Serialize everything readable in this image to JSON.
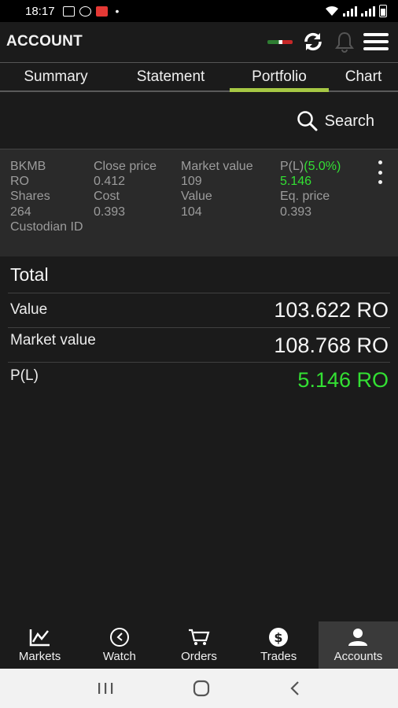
{
  "status_bar": {
    "time": "18:17",
    "dot": "•"
  },
  "header": {
    "title": "ACCOUNT"
  },
  "tabs": [
    {
      "label": "Summary"
    },
    {
      "label": "Statement"
    },
    {
      "label": "Portfolio",
      "active": true
    },
    {
      "label": "Chart"
    }
  ],
  "search": {
    "label": "Search"
  },
  "holding": {
    "symbol": "BKMB",
    "currency": "RO",
    "close_price_label": "Close price",
    "close_price": "0.412",
    "market_value_label": "Market value",
    "market_value": "109",
    "pl_label": "P(L)",
    "pl_percent": "(5.0%)",
    "pl_value": "5.146",
    "shares_label": "Shares",
    "shares": "264",
    "cost_label": "Cost",
    "cost": "0.393",
    "value_label": "Value",
    "value": "104",
    "eq_price_label": "Eq. price",
    "eq_price": "0.393",
    "custodian_label": "Custodian ID"
  },
  "total": {
    "title": "Total",
    "rows": [
      {
        "label": "Value",
        "value": "103.622 RO"
      },
      {
        "label": "Market value",
        "value": "108.768 RO"
      },
      {
        "label": "P(L)",
        "value": "5.146 RO"
      }
    ]
  },
  "bottom_nav": [
    {
      "label": "Markets",
      "icon": "chart-icon"
    },
    {
      "label": "Watch",
      "icon": "clock-icon"
    },
    {
      "label": "Orders",
      "icon": "cart-icon"
    },
    {
      "label": "Trades",
      "icon": "dollar-icon"
    },
    {
      "label": "Accounts",
      "icon": "user-icon",
      "active": true
    }
  ],
  "colors": {
    "background": "#1b1b1b",
    "holding_panel": "#2a2a2a",
    "accent_tab": "#a6c844",
    "positive": "#33e033",
    "muted_text": "#9c9c9c"
  }
}
